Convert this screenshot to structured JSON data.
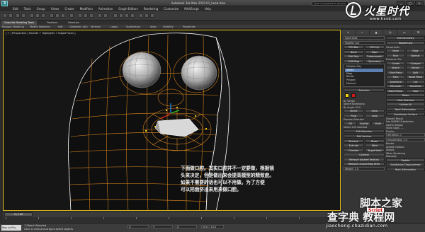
{
  "titlebar": {
    "logo": "3",
    "title": "Autodesk 3ds Max 2010    01_head.max",
    "search_placeholder": "Type a keyword or phrase",
    "buttons": [
      "_",
      "□",
      "×"
    ]
  },
  "menu": [
    "Edit",
    "Tools",
    "Group",
    "Views",
    "Create",
    "Modifiers",
    "Animation",
    "Graph Editors",
    "Rendering",
    "Customize",
    "MAXScript",
    "Help"
  ],
  "ribbon": {
    "tabs": [
      "Graphite Modeling Tools",
      "Freeform",
      "Selection"
    ],
    "row": [
      "Polygon Modeling",
      "Modify Selection",
      "Edit",
      "Geometry (All)",
      "Vertices",
      "Loops",
      "Subdivision",
      "Align",
      "Visibility",
      "Properties"
    ]
  },
  "viewport": {
    "label": "[ + ] Perspective | Smooth + Highlights + Edged Faces ]",
    "annotation": [
      "下面做口腔。其实口腔并不一定要做，根据镜",
      "头来决定，但是做出来会提高模型的精致度。",
      "如果不需要的话也可以不用做。为了方便",
      "可以把面挤出来用来做口腔。"
    ]
  },
  "timeline": {
    "slider": "0 / 100",
    "ticks": [
      "0",
      "10",
      "20",
      "30",
      "40",
      "50",
      "60",
      "70",
      "80",
      "90",
      "100"
    ]
  },
  "status": {
    "selection": "Max to Phy.",
    "objects": "1 Object Selected",
    "hint": "Click or click-and-drag to select objects",
    "coords": [
      "X:",
      "Y:",
      "Z:",
      "Grid = 10.0"
    ]
  },
  "command_panel": {
    "tabs": [
      "+",
      "~",
      "▲",
      "◎",
      "▭",
      "⚒"
    ],
    "object_name": "Sphere001",
    "modifier_list": "Modifier List",
    "col1_buttons": [
      [
        "FFD Box",
        "FFD Cyl"
      ],
      [
        "Bend",
        "Taper"
      ],
      [
        "Edit Poly",
        "Turbosmooth"
      ],
      [
        "UVW Map",
        "Symmetry"
      ]
    ],
    "stack": [
      "Editable Poly",
      "Vertex",
      "Edge",
      "Border",
      "Polygon",
      "Element"
    ],
    "selection_rollout": "Selection",
    "swatches": [
      "#f0d21a",
      "#d11a1a"
    ],
    "by_vertex": "By Vertex",
    "ignore_backfacing": "Ignore Backfacing",
    "by_angle": "By Angle: 45.0",
    "shrink": "Shrink",
    "grow": "Grow",
    "ring": "Ring",
    "loop": "Loop",
    "preview_selection": "Preview Selection",
    "preview_opts": [
      "Off",
      "SubObj",
      "Multi"
    ],
    "vertices_selected": "Vertex 235 Selected",
    "soft_selection": "Soft Selection",
    "edit_vertices": "Edit Vertices",
    "remove": "Remove",
    "break": "Break",
    "extrude": "Extrude",
    "weld": "Weld",
    "chamfer": "Chamfer",
    "target_weld": "Target Weld",
    "connect": "Connect",
    "remove_isolated": "Remove Isolated Vertices",
    "remove_unused": "Remove Unused Map Verts",
    "weight": "Weight:  1.0",
    "edit_geometry": "Edit Geometry",
    "repeat_last": "Repeat Last",
    "constraints": "Constraints",
    "constraint_opts": [
      "None",
      "Edge"
    ],
    "face": "Face",
    "normal": "Normal",
    "preserve_uvs": "Preserve UVs",
    "create": "Create",
    "collapse": "Collapse",
    "attach": "Attach",
    "detach": "Detach",
    "slice_plane": "Slice Plane",
    "split": "Split",
    "slice": "Slice",
    "reset_plane": "Reset Plane",
    "quickslice": "QuickSlice",
    "cut": "Cut",
    "msmooth": "MSmooth",
    "tessellate": "Tessellate",
    "make_planar": "Make Planar",
    "view": "View",
    "relax": "Relax",
    "hide_selected": "Hide Selected",
    "unhide_all": "Unhide All",
    "paint_deformation": "Paint Deformation",
    "subdivision_surface": "Subdivision Surface",
    "smooth_result": "Smooth Result",
    "use_nurms": "Use NURMS Subdivision",
    "isoline": "Isoline Display",
    "show_cage": "Show Cage......",
    "display": "Display",
    "iterations": "Iterations:  1",
    "smoothness": "Smoothness:  1.0",
    "render": "Render",
    "update_options": "Update Options",
    "always": "Always",
    "when_rendering": "When Rendering",
    "manually": "Manually",
    "update": "Update",
    "subdivision_disp": "Subdivision Displacement",
    "paint_def": "Paint Deformation"
  },
  "watermark_top": {
    "brand": "火星时代",
    "site": "www.hxsd.com"
  },
  "watermark_bottom": {
    "line1": "脚本之家",
    "line1_sub": "Script",
    "line2": "查字典 教程网",
    "line3": "jiaocheng.chazidian.com"
  },
  "colors": {
    "viewport_border": "#e3c21a",
    "wire_orange": "#e08a1f",
    "wire_white": "#ffffff",
    "accent": "#5b7fb0"
  }
}
